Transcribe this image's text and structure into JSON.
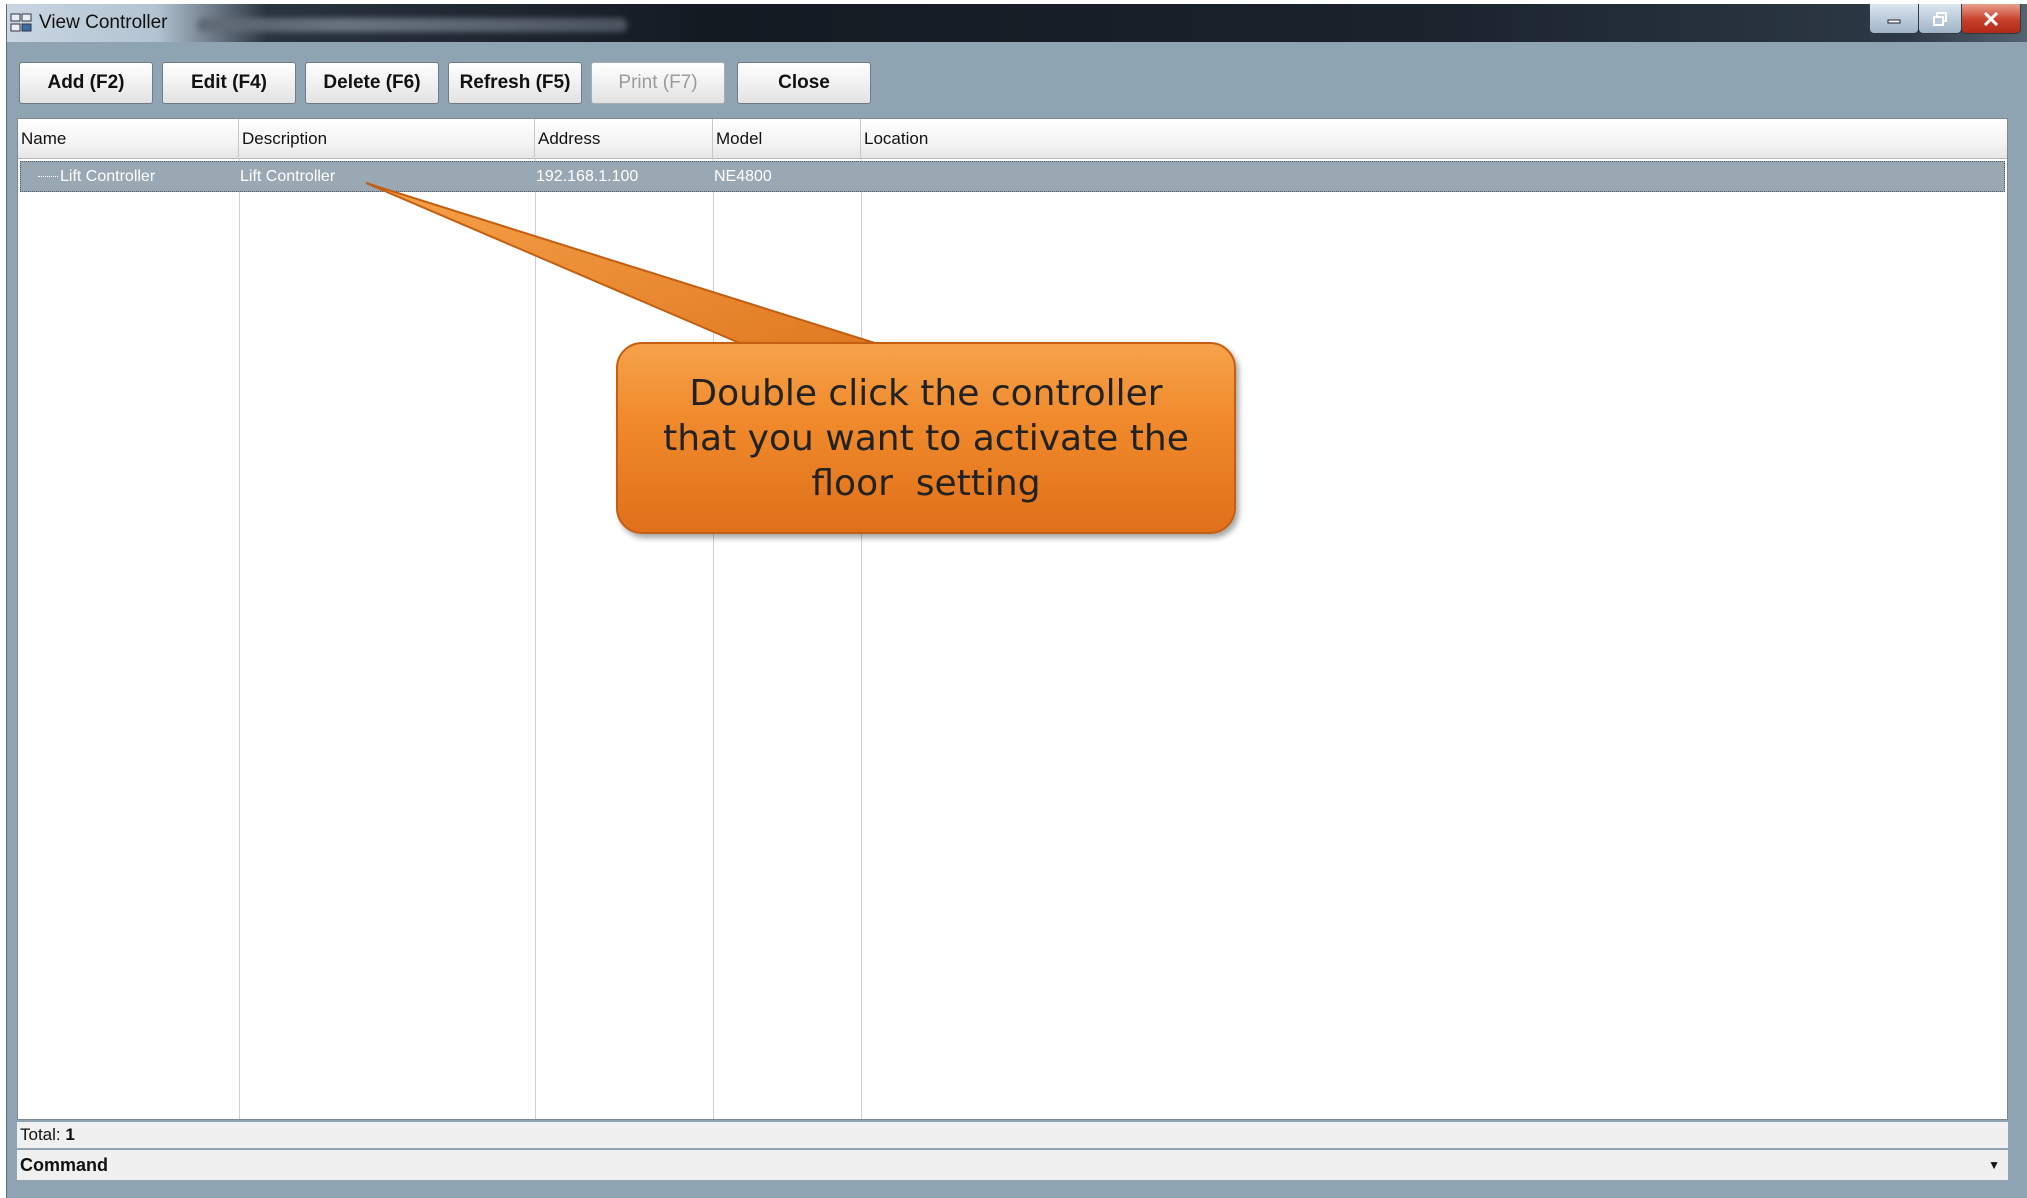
{
  "window": {
    "title": "View Controller"
  },
  "toolbar": {
    "buttons": [
      {
        "label": "Add (F2)",
        "enabled": true
      },
      {
        "label": "Edit (F4)",
        "enabled": true
      },
      {
        "label": "Delete (F6)",
        "enabled": true
      },
      {
        "label": "Refresh (F5)",
        "enabled": true
      },
      {
        "label": "Print (F7)",
        "enabled": false
      },
      {
        "label": "Close",
        "enabled": true
      }
    ]
  },
  "grid": {
    "columns": [
      "Name",
      "Description",
      "Address",
      "Model",
      "Location"
    ],
    "rows": [
      {
        "name": "Lift Controller",
        "description": "Lift Controller",
        "address": "192.168.1.100",
        "model": "NE4800",
        "location": ""
      }
    ]
  },
  "status": {
    "total_label": "Total:",
    "total_value": "1",
    "command_label": "Command"
  },
  "callout": {
    "line1": "Double click the controller",
    "line2": "that you want to activate the",
    "line3": "floor  setting"
  },
  "colors": {
    "window_bg": "#8fa4b3",
    "selected_row": "#9aa8b4",
    "callout": "#f08a2c"
  },
  "icons": [
    "app-icon",
    "minimize-icon",
    "maximize-icon",
    "close-icon",
    "dropdown-arrow-icon"
  ]
}
